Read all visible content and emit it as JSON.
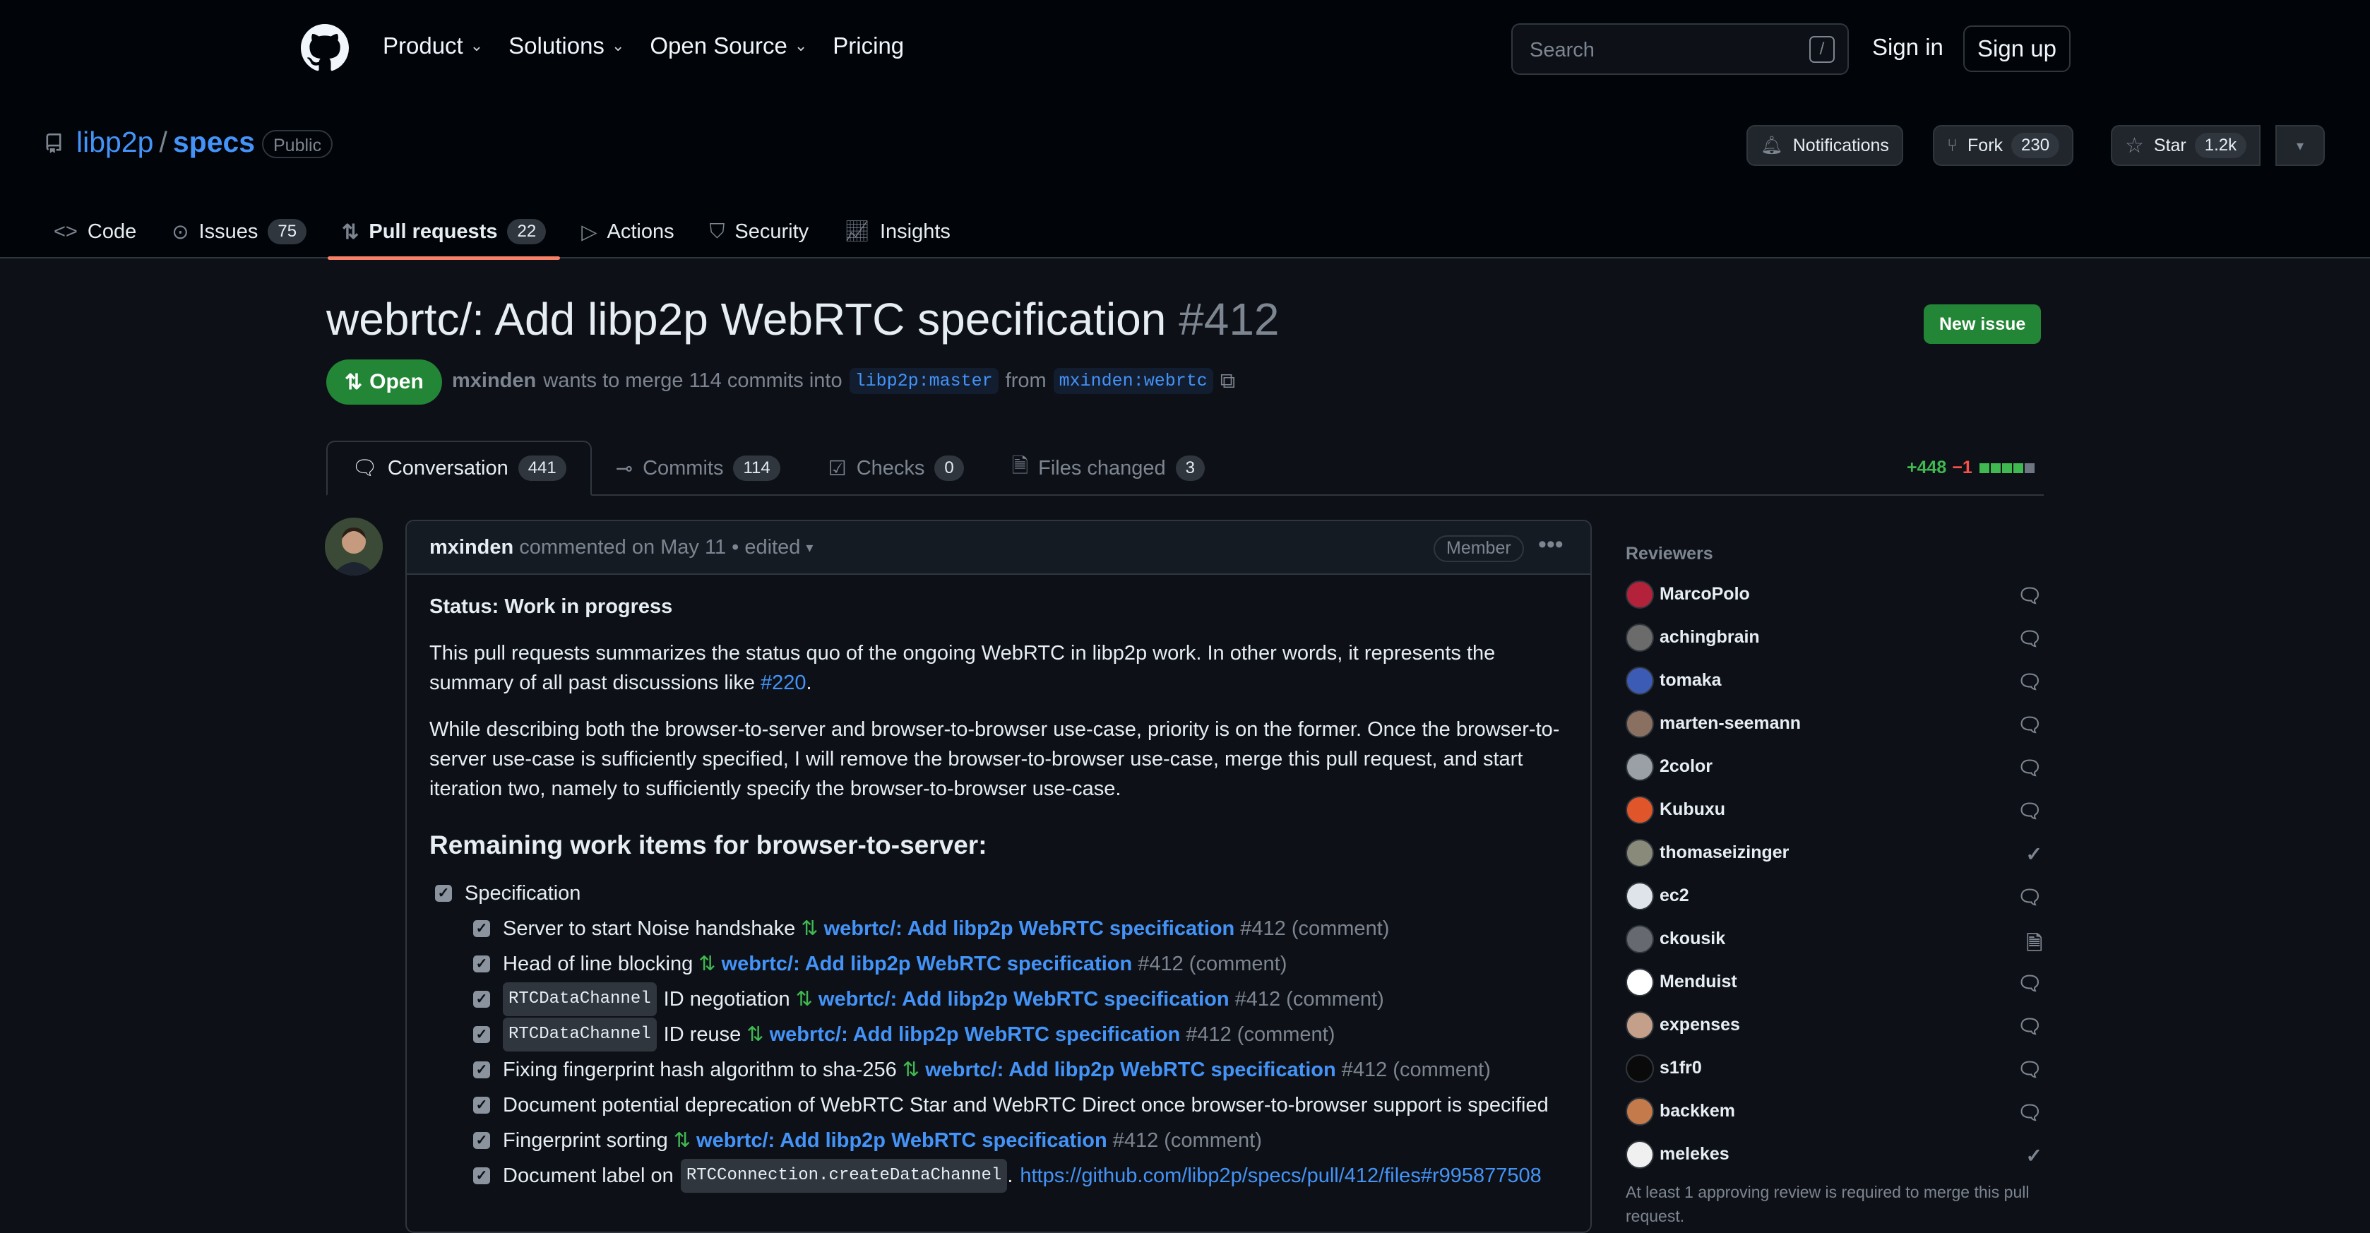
{
  "header": {
    "nav": [
      "Product",
      "Solutions",
      "Open Source",
      "Pricing"
    ],
    "nav_has_chevron": [
      true,
      true,
      true,
      false
    ],
    "search_placeholder": "Search",
    "search_key": "/",
    "signin": "Sign in",
    "signup": "Sign up"
  },
  "repo": {
    "owner": "libp2p",
    "separator": "/",
    "name": "specs",
    "visibility": "Public",
    "notifications": "Notifications",
    "fork": "Fork",
    "fork_count": "230",
    "star": "Star",
    "star_count": "1.2k"
  },
  "repo_tabs": [
    {
      "label": "Code",
      "count": ""
    },
    {
      "label": "Issues",
      "count": "75"
    },
    {
      "label": "Pull requests",
      "count": "22",
      "selected": true
    },
    {
      "label": "Actions",
      "count": ""
    },
    {
      "label": "Security",
      "count": ""
    },
    {
      "label": "Insights",
      "count": ""
    }
  ],
  "pr": {
    "title": "webrtc/: Add libp2p WebRTC specification",
    "number": "#412",
    "new_issue": "New issue",
    "status": "Open",
    "author": "mxinden",
    "merge_text": "wants to merge 114 commits into",
    "base": "libp2p:master",
    "from": "from",
    "head": "mxinden:webrtc"
  },
  "pr_tabs": [
    {
      "label": "Conversation",
      "count": "441",
      "selected": true
    },
    {
      "label": "Commits",
      "count": "114"
    },
    {
      "label": "Checks",
      "count": "0"
    },
    {
      "label": "Files changed",
      "count": "3"
    }
  ],
  "diffstat": {
    "additions": "+448",
    "deletions": "−1",
    "blocks": [
      "#3fb950",
      "#3fb950",
      "#3fb950",
      "#3fb950",
      "#6e7681"
    ]
  },
  "comment": {
    "author": "mxinden",
    "meta": "commented on May 11 • edited",
    "role": "Member",
    "status": "Status: Work in progress",
    "p1_text": "This pull requests summarizes the status quo of the ongoing WebRTC in libp2p work. In other words, it represents the summary of all past discussions like ",
    "p1_link": "#220",
    "p1_end": ".",
    "p2": "While describing both the browser-to-server and browser-to-browser use-case, priority is on the former. Once the browser-to-server use-case is sufficiently specified, I will remove the browser-to-browser use-case, merge this pull request, and start iteration two, namely to sufficiently specify the browser-to-browser use-case.",
    "heading": "Remaining work items for browser-to-server:",
    "top_task": "Specification",
    "tasks": [
      {
        "code": "",
        "text": "Server to start Noise handshake",
        "pr": "webrtc/: Add libp2p WebRTC specification",
        "suffix": "#412 (comment)",
        "link": ""
      },
      {
        "code": "",
        "text": "Head of line blocking",
        "pr": "webrtc/: Add libp2p WebRTC specification",
        "suffix": "#412 (comment)",
        "link": ""
      },
      {
        "code": "RTCDataChannel",
        "text": "ID negotiation",
        "pr": "webrtc/: Add libp2p WebRTC specification",
        "suffix": "#412 (comment)",
        "link": ""
      },
      {
        "code": "RTCDataChannel",
        "text": "ID reuse",
        "pr": "webrtc/: Add libp2p WebRTC specification",
        "suffix": "#412 (comment)",
        "link": ""
      },
      {
        "code": "",
        "text": "Fixing fingerprint hash algorithm to sha-256",
        "pr": "webrtc/: Add libp2p WebRTC specification",
        "suffix": "#412 (comment)",
        "link": ""
      },
      {
        "code": "",
        "text": "Document potential deprecation of WebRTC Star and WebRTC Direct once browser-to-browser support is specified",
        "pr": "",
        "suffix": "",
        "link": ""
      },
      {
        "code": "",
        "text": "Fingerprint sorting",
        "pr": "webrtc/: Add libp2p WebRTC specification",
        "suffix": "#412 (comment)",
        "link": ""
      },
      {
        "code": "RTCConnection.createDataChannel",
        "text": "Document label on",
        "pr": "",
        "suffix": "",
        "link": "https://github.com/libp2p/specs/pull/412/files#r995877508",
        "code_after": true
      }
    ]
  },
  "sidebar": {
    "heading": "Reviewers",
    "reviewers": [
      {
        "name": "MarcoPolo",
        "state": "comment",
        "color": "#b3223a"
      },
      {
        "name": "achingbrain",
        "state": "comment",
        "color": "#6b6b6b"
      },
      {
        "name": "tomaka",
        "state": "comment",
        "color": "#3b5bb5"
      },
      {
        "name": "marten-seemann",
        "state": "comment",
        "color": "#8a7060"
      },
      {
        "name": "2color",
        "state": "comment",
        "color": "#9aa0a6"
      },
      {
        "name": "Kubuxu",
        "state": "comment",
        "color": "#e0562a"
      },
      {
        "name": "thomaseizinger",
        "state": "approved",
        "color": "#8a8a7a"
      },
      {
        "name": "ec2",
        "state": "comment",
        "color": "#dfe3ea"
      },
      {
        "name": "ckousik",
        "state": "file",
        "color": "#666a70"
      },
      {
        "name": "Menduist",
        "state": "comment",
        "color": "#ffffff"
      },
      {
        "name": "expenses",
        "state": "comment",
        "color": "#c4a08a"
      },
      {
        "name": "s1fr0",
        "state": "comment",
        "color": "#0a0a0a"
      },
      {
        "name": "backkem",
        "state": "comment",
        "color": "#c47a4a"
      },
      {
        "name": "melekes",
        "state": "approved",
        "color": "#f0f0f0"
      }
    ],
    "note": "At least 1 approving review is required to merge this pull request."
  }
}
